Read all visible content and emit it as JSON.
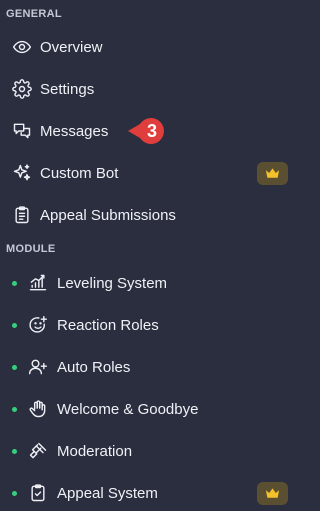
{
  "sections": {
    "general": "GENERAL",
    "module": "MODULE"
  },
  "general_items": [
    {
      "label": "Overview",
      "icon": "eye-icon"
    },
    {
      "label": "Settings",
      "icon": "gear-icon"
    },
    {
      "label": "Messages",
      "icon": "chat-bubbles-icon"
    },
    {
      "label": "Custom Bot",
      "icon": "sparkles-icon",
      "premium": true
    },
    {
      "label": "Appeal Submissions",
      "icon": "clipboard-list-icon"
    }
  ],
  "module_items": [
    {
      "label": "Leveling System",
      "icon": "chart-bars-icon",
      "status_color": "#35d07f"
    },
    {
      "label": "Reaction Roles",
      "icon": "smiley-plus-icon",
      "status_color": "#35d07f"
    },
    {
      "label": "Auto Roles",
      "icon": "user-plus-icon",
      "status_color": "#35d07f"
    },
    {
      "label": "Welcome & Goodbye",
      "icon": "hand-wave-icon",
      "status_color": "#35d07f"
    },
    {
      "label": "Moderation",
      "icon": "gavel-icon",
      "status_color": "#35d07f"
    },
    {
      "label": "Appeal System",
      "icon": "clipboard-check-icon",
      "status_color": "#35d07f",
      "premium": true
    }
  ],
  "annotation": {
    "number": "3",
    "color": "#e03d3d"
  },
  "colors": {
    "background": "#2b2e3f",
    "premium_badge": "#5a5031",
    "crown": "#f3c12c"
  }
}
